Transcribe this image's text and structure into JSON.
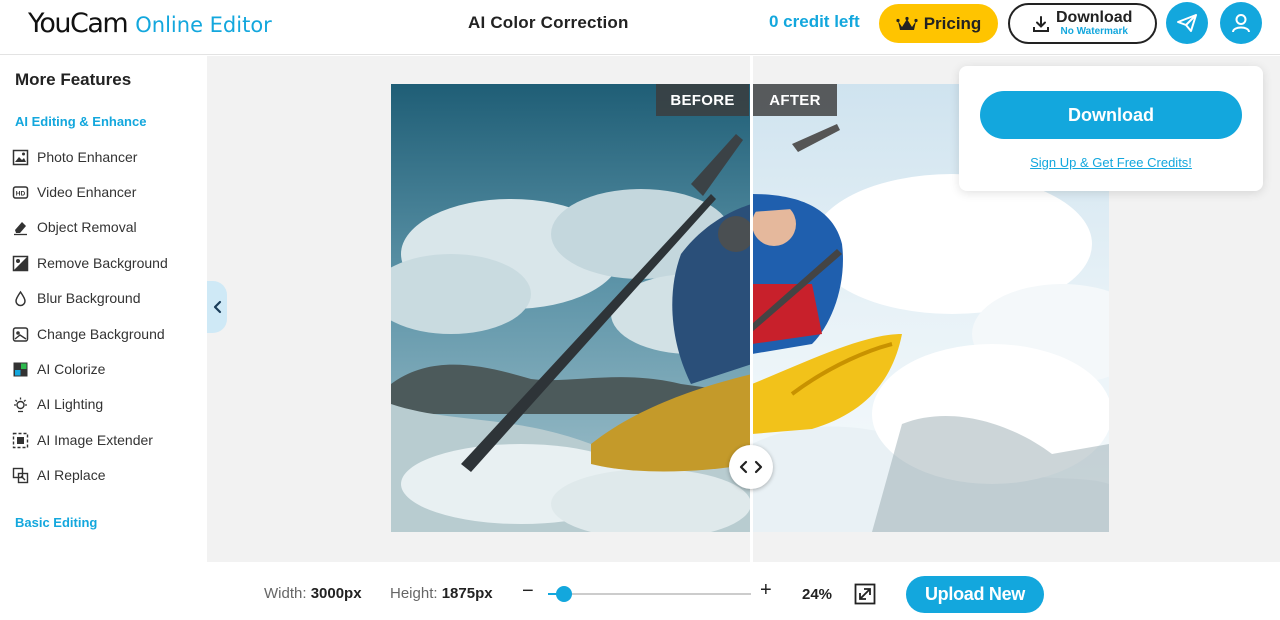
{
  "header": {
    "logo_main": "YouCam",
    "logo_sub": "Online Editor",
    "page_title": "AI Color Correction",
    "credit_text": "0 credit left",
    "pricing_label": "Pricing",
    "download_label": "Download",
    "download_sub": "No Watermark"
  },
  "sidebar": {
    "title": "More Features",
    "section_ai": "AI Editing & Enhance",
    "items": [
      {
        "label": "Photo Enhancer",
        "icon": "photo-enhancer-icon"
      },
      {
        "label": "Video Enhancer",
        "icon": "hd-video-icon"
      },
      {
        "label": "Object Removal",
        "icon": "eraser-icon"
      },
      {
        "label": "Remove Background",
        "icon": "remove-background-icon"
      },
      {
        "label": "Blur Background",
        "icon": "droplet-icon"
      },
      {
        "label": "Change Background",
        "icon": "change-background-icon"
      },
      {
        "label": "AI Colorize",
        "icon": "colorize-icon"
      },
      {
        "label": "AI Lighting",
        "icon": "sun-icon"
      },
      {
        "label": "AI Image Extender",
        "icon": "expand-frame-icon"
      },
      {
        "label": "AI Replace",
        "icon": "replace-icon"
      }
    ],
    "section_basic": "Basic Editing"
  },
  "canvas": {
    "before_label": "BEFORE",
    "after_label": "AFTER"
  },
  "popup": {
    "download_label": "Download",
    "signup_link": "Sign Up & Get Free Credits!"
  },
  "footer": {
    "width_label": "Width:",
    "width_value": "3000px",
    "height_label": "Height:",
    "height_value": "1875px",
    "zoom_minus": "−",
    "zoom_plus": "+",
    "zoom_value": "24%",
    "zoom_fraction": 0.08,
    "upload_label": "Upload New"
  },
  "colors": {
    "accent": "#13a7dd",
    "pricing": "#ffc400",
    "kayak": "#f2c21a",
    "jacket": "#1f5fae"
  }
}
